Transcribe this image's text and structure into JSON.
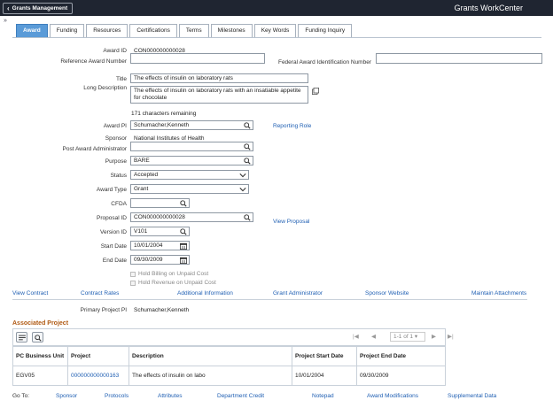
{
  "header": {
    "back_label": "Grants Management",
    "app_title": "Grants WorkCenter"
  },
  "tabs": [
    {
      "label": "Award",
      "active": true
    },
    {
      "label": "Funding"
    },
    {
      "label": "Resources"
    },
    {
      "label": "Certifications"
    },
    {
      "label": "Terms"
    },
    {
      "label": "Milestones"
    },
    {
      "label": "Key Words"
    },
    {
      "label": "Funding Inquiry"
    }
  ],
  "form": {
    "award_id_label": "Award ID",
    "award_id": "CON000000000028",
    "ref_award_label": "Reference Award Number",
    "ref_award": "",
    "federal_id_label": "Federal Award Identification Number",
    "federal_id": "",
    "title_label": "Title",
    "title": "The effects of insulin on laboratory rats",
    "long_desc_label": "Long Description",
    "long_desc": "The effects of insulin on laboratory rats with an insatiable appetite for chocolate",
    "chars_remaining": "171 characters remaining",
    "award_pi_label": "Award PI",
    "award_pi": "Schumacher,Kenneth",
    "reporting_role": "Reporting Role",
    "sponsor_label": "Sponsor",
    "sponsor": "National Institutes of Health",
    "post_admin_label": "Post Award Administrator",
    "post_admin": "",
    "purpose_label": "Purpose",
    "purpose": "BARE",
    "status_label": "Status",
    "status": "Accepted",
    "award_type_label": "Award Type",
    "award_type": "Grant",
    "cfda_label": "CFDA",
    "cfda": "",
    "proposal_id_label": "Proposal ID",
    "proposal_id": "CON000000000028",
    "view_proposal": "View Proposal",
    "version_id_label": "Version ID",
    "version_id": "V101",
    "start_date_label": "Start Date",
    "start_date": "10/01/2004",
    "end_date_label": "End Date",
    "end_date": "09/30/2009",
    "hold_billing": "Hold Billing on Unpaid Cost",
    "hold_revenue": "Hold Revenue on Unpaid Cost"
  },
  "links_row": [
    "View Contract",
    "Contract Rates",
    "Additional Information",
    "Grant Administrator",
    "Sponsor Website",
    "Maintain Attachments"
  ],
  "primary_pi_label": "Primary Project PI",
  "primary_pi": "Schumacher,Kenneth",
  "associated": {
    "title": "Associated Project",
    "pager": "1-1 of 1",
    "columns": [
      "PC Business Unit",
      "Project",
      "Description",
      "Project Start Date",
      "Project End Date"
    ],
    "rows": [
      [
        "EGV05",
        "000000000000163",
        "The effects of insulin on labo",
        "10/01/2004",
        "09/30/2009"
      ]
    ]
  },
  "goto": {
    "label": "Go To:",
    "links": [
      "Sponsor",
      "Protocols",
      "Attributes",
      "Department Credit",
      "Notepad",
      "Award Modifications",
      "Supplemental Data"
    ]
  },
  "colors": {
    "topbar": "#1f2531",
    "active_tab": "#5a9bd8",
    "link": "#1f5fb3",
    "section": "#b05a14"
  }
}
